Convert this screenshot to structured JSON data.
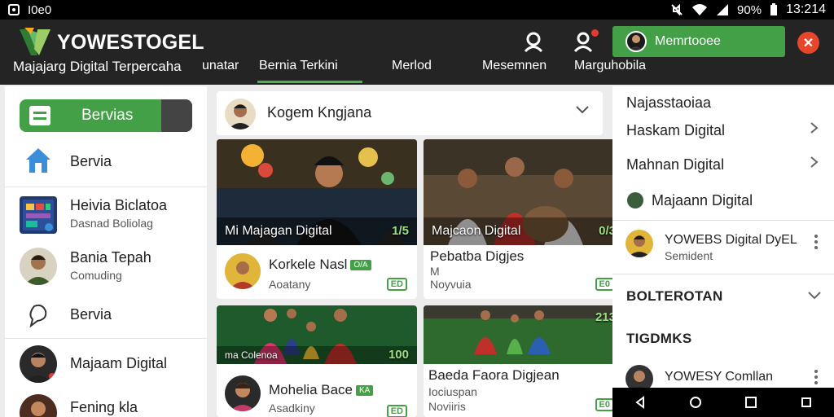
{
  "status_bar": {
    "app_label": "I0e0",
    "battery": "90%",
    "time": "13:214"
  },
  "header": {
    "brand": "YOWESTOGEL",
    "tagline": "Majajarg Digital Terpercaha",
    "nav": [
      "unatar",
      "Bernia Terkini",
      "Merlod",
      "Mesemnen",
      "Marguhobila"
    ],
    "active_nav": "Bernia Terkini",
    "member_label": "Memrtooee",
    "accent_color": "#43a047"
  },
  "sidebar": {
    "button_label": "Bervias",
    "items": [
      {
        "title": "Bervia",
        "subtitle": ""
      },
      {
        "title": "Heivia Biclatoa",
        "subtitle": "Dasnad Boliolag"
      },
      {
        "title": "Bania Tepah",
        "subtitle": "Comuding"
      },
      {
        "title": "Bervia",
        "subtitle": ""
      },
      {
        "title": "Majaam Digital",
        "subtitle": ""
      },
      {
        "title": "Fening kla",
        "subtitle": ""
      }
    ]
  },
  "feed": {
    "author": "Kogem Kngjana",
    "cards": [
      {
        "caption": "Mi Majagan Digital",
        "number": "1/5",
        "sub_title": "Korkele Nasl",
        "badge": "O/A",
        "sub_text": "Aoatany",
        "pill": "ED"
      },
      {
        "caption": "Majcaon Digital",
        "number": "0/3",
        "sub_title": "Pebatba Digjes",
        "badge": "",
        "sub_text": "Noyvuia",
        "pill": "E0",
        "extra": "M"
      },
      {
        "caption": "ma Colenoa",
        "number": "100",
        "sub_title": "Mohelia Bace",
        "badge": "KA",
        "sub_text": "Asadkiny",
        "pill": "ED"
      },
      {
        "caption": "",
        "number": "213",
        "sub_title": "Baeda Faora Digjean",
        "badge": "",
        "sub_text": "Noviiris",
        "pill": "E0",
        "extra": "Iociuspan"
      }
    ]
  },
  "right_panel": {
    "title": "Najasstaoiaa",
    "links": [
      "Haskam Digital",
      "Mahnan Digital",
      "Majaann Digital"
    ],
    "profile_name": "YOWEBS Digital DyEL",
    "profile_sub": "Semident",
    "section1": "BOLTEROTAN",
    "section2": "TIGDMKS",
    "bottom_item": "YOWESY Comllan"
  }
}
